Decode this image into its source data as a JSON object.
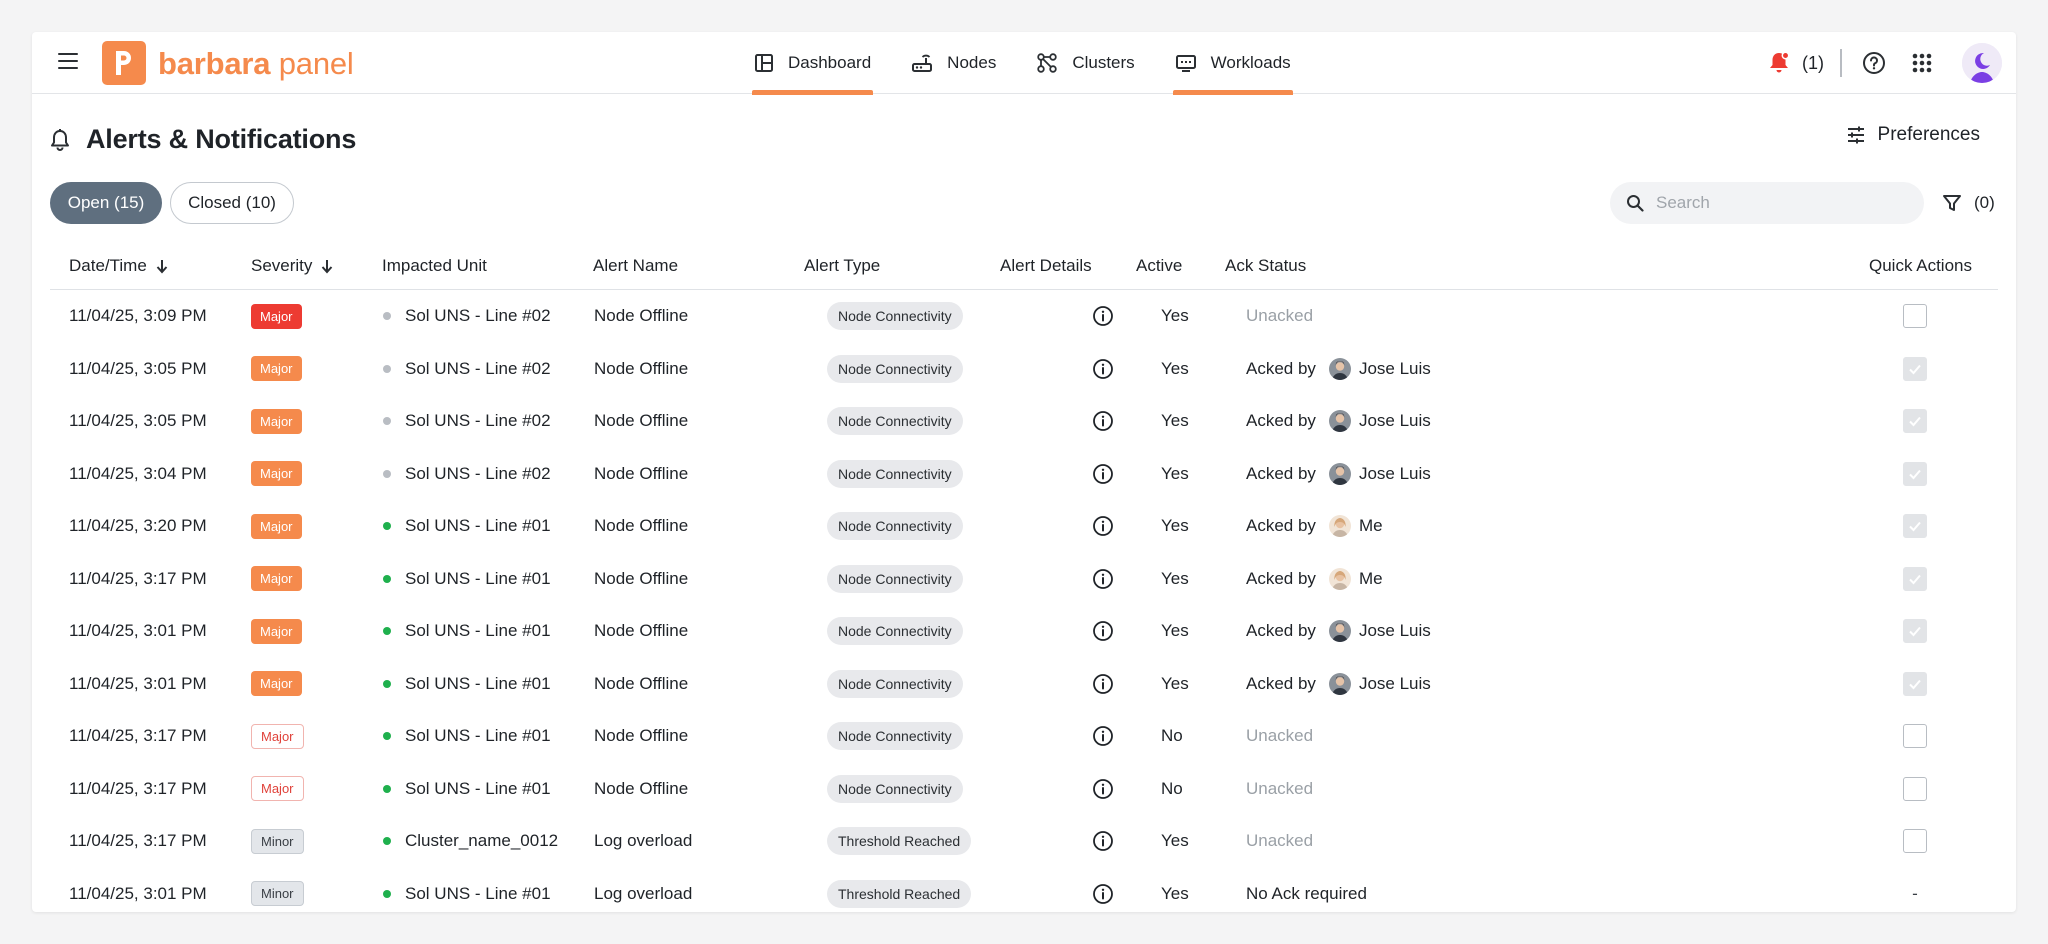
{
  "app": {
    "logo_letter": "p",
    "logo_bold": "barbara",
    "logo_light": " panel",
    "brand_color": "#f58a4c"
  },
  "nav": [
    {
      "label": "Dashboard",
      "icon": "dashboard-icon",
      "active": true
    },
    {
      "label": "Nodes",
      "icon": "router-icon",
      "active": false
    },
    {
      "label": "Clusters",
      "icon": "cluster-icon",
      "active": false
    },
    {
      "label": "Workloads",
      "icon": "monitor-icon",
      "active": true
    }
  ],
  "topbar": {
    "notification_count": "(1)"
  },
  "page": {
    "title": "Alerts & Notifications",
    "preferences_label": "Preferences"
  },
  "tabs": {
    "open_label": "Open (15)",
    "closed_label": "Closed (10)"
  },
  "search": {
    "placeholder": "Search",
    "value": ""
  },
  "filter": {
    "count": "(0)"
  },
  "table": {
    "columns": [
      "Date/Time",
      "Severity",
      "Impacted Unit",
      "Alert Name",
      "Alert Type",
      "Alert Details",
      "Active",
      "Ack Status",
      "Quick Actions"
    ],
    "rows": [
      {
        "datetime": "11/04/25, 3:09 PM",
        "severity": "Major",
        "sev_style": "major-red",
        "unit_status": "gray",
        "unit": "Sol UNS - Line #02",
        "alert_name": "Node Offline",
        "alert_type": "Node Connectivity",
        "active": "Yes",
        "ack_kind": "unacked",
        "ack_text": "Unacked",
        "ack_user": "",
        "quick": "box"
      },
      {
        "datetime": "11/04/25, 3:05 PM",
        "severity": "Major",
        "sev_style": "major-orange",
        "unit_status": "gray",
        "unit": "Sol UNS - Line #02",
        "alert_name": "Node Offline",
        "alert_type": "Node Connectivity",
        "active": "Yes",
        "ack_kind": "acked",
        "ack_text": "Acked by",
        "ack_user": "Jose Luis",
        "quick": "checked"
      },
      {
        "datetime": "11/04/25, 3:05 PM",
        "severity": "Major",
        "sev_style": "major-orange",
        "unit_status": "gray",
        "unit": "Sol UNS - Line #02",
        "alert_name": "Node Offline",
        "alert_type": "Node Connectivity",
        "active": "Yes",
        "ack_kind": "acked",
        "ack_text": "Acked by",
        "ack_user": "Jose Luis",
        "quick": "checked"
      },
      {
        "datetime": "11/04/25, 3:04 PM",
        "severity": "Major",
        "sev_style": "major-orange",
        "unit_status": "gray",
        "unit": "Sol UNS - Line #02",
        "alert_name": "Node Offline",
        "alert_type": "Node Connectivity",
        "active": "Yes",
        "ack_kind": "acked",
        "ack_text": "Acked by",
        "ack_user": "Jose Luis",
        "quick": "checked"
      },
      {
        "datetime": "11/04/25, 3:20 PM",
        "severity": "Major",
        "sev_style": "major-orange",
        "unit_status": "green",
        "unit": "Sol UNS - Line #01",
        "alert_name": "Node Offline",
        "alert_type": "Node Connectivity",
        "active": "Yes",
        "ack_kind": "acked",
        "ack_text": "Acked by",
        "ack_user": "Me",
        "quick": "checked"
      },
      {
        "datetime": "11/04/25, 3:17 PM",
        "severity": "Major",
        "sev_style": "major-orange",
        "unit_status": "green",
        "unit": "Sol UNS - Line #01",
        "alert_name": "Node Offline",
        "alert_type": "Node Connectivity",
        "active": "Yes",
        "ack_kind": "acked",
        "ack_text": "Acked by",
        "ack_user": "Me",
        "quick": "checked"
      },
      {
        "datetime": "11/04/25, 3:01 PM",
        "severity": "Major",
        "sev_style": "major-orange",
        "unit_status": "green",
        "unit": "Sol UNS - Line #01",
        "alert_name": "Node Offline",
        "alert_type": "Node Connectivity",
        "active": "Yes",
        "ack_kind": "acked",
        "ack_text": "Acked by",
        "ack_user": "Jose Luis",
        "quick": "checked"
      },
      {
        "datetime": "11/04/25, 3:01 PM",
        "severity": "Major",
        "sev_style": "major-orange",
        "unit_status": "green",
        "unit": "Sol UNS - Line #01",
        "alert_name": "Node Offline",
        "alert_type": "Node Connectivity",
        "active": "Yes",
        "ack_kind": "acked",
        "ack_text": "Acked by",
        "ack_user": "Jose Luis",
        "quick": "checked"
      },
      {
        "datetime": "11/04/25, 3:17 PM",
        "severity": "Major",
        "sev_style": "major-outline",
        "unit_status": "green",
        "unit": "Sol UNS - Line #01",
        "alert_name": "Node Offline",
        "alert_type": "Node Connectivity",
        "active": "No",
        "ack_kind": "unacked",
        "ack_text": "Unacked",
        "ack_user": "",
        "quick": "box"
      },
      {
        "datetime": "11/04/25, 3:17 PM",
        "severity": "Major",
        "sev_style": "major-outline",
        "unit_status": "green",
        "unit": "Sol UNS - Line #01",
        "alert_name": "Node Offline",
        "alert_type": "Node Connectivity",
        "active": "No",
        "ack_kind": "unacked",
        "ack_text": "Unacked",
        "ack_user": "",
        "quick": "box"
      },
      {
        "datetime": "11/04/25, 3:17 PM",
        "severity": "Minor",
        "sev_style": "minor",
        "unit_status": "green",
        "unit": "Cluster_name_0012",
        "alert_name": "Log overload",
        "alert_type": "Threshold Reached",
        "active": "Yes",
        "ack_kind": "unacked",
        "ack_text": "Unacked",
        "ack_user": "",
        "quick": "box"
      },
      {
        "datetime": "11/04/25, 3:01 PM",
        "severity": "Minor",
        "sev_style": "minor",
        "unit_status": "green",
        "unit": "Sol UNS - Line #01",
        "alert_name": "Log overload",
        "alert_type": "Threshold Reached",
        "active": "Yes",
        "ack_kind": "none",
        "ack_text": "No Ack required",
        "ack_user": "",
        "quick": "dash"
      }
    ]
  },
  "colors": {
    "accent": "#f58a4c",
    "major_red": "#ed3b32",
    "status_green": "#1fb04d",
    "status_gray": "#b9bdc3",
    "tab_active": "#5f6f7f"
  }
}
